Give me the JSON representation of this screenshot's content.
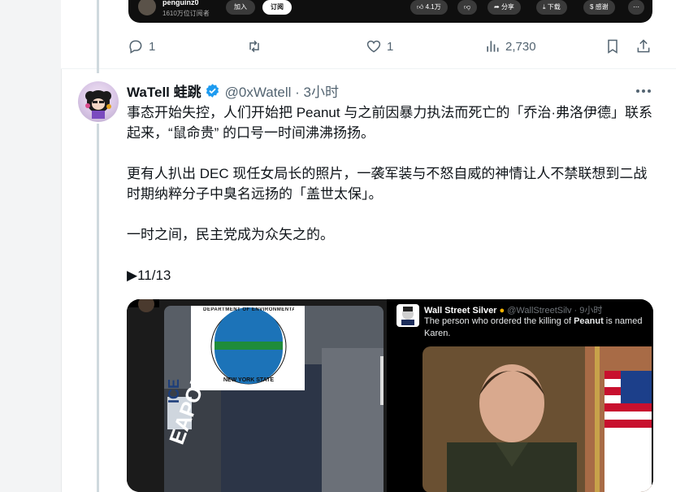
{
  "prev_media": {
    "channel_name": "penguinz0",
    "subscribers": "1610万位订阅者",
    "join_label": "加入",
    "subscribe_label": "订阅",
    "likes": "4.1万",
    "share_label": "分享",
    "download_label": "下载",
    "thanks_label": "感谢"
  },
  "prev_actions": {
    "replies": "1",
    "likes": "1",
    "views": "2,730"
  },
  "tweet": {
    "display_name": "WaTell 蛙跳",
    "handle_time": "@0xWatell · 3小时",
    "paragraphs": [
      "事态开始失控，人们开始把 Peanut 与之前因暴力执法而死亡的「乔治·弗洛伊德」联系起来，“鼠命贵” 的口号一时间沸沸扬扬。",
      "更有人扒出 DEC 现任女局长的照片，一袭军装与不怒自威的神情让人不禁联想到二战时期纳粹分子中臭名远扬的「盖世太保」。",
      "一时之间，民主党成为众矢之的。",
      "▶11/13"
    ],
    "embedded": {
      "seal_top": "DEPARTMENT OF ENVIRONMENTAL CONSERVATION",
      "seal_bottom": "NEW YORK STATE",
      "car_text_1": "ICE",
      "car_text_2": "EAPOLIS",
      "quoted_name": "Wall Street Silver",
      "quoted_handle_time": "@WallStreetSilv · 9小时",
      "quoted_text_before": "The person who ordered the killing of ",
      "quoted_text_bold": "Peanut",
      "quoted_text_after": " is named Karen."
    }
  },
  "colors": {
    "verified": "#1d9bf0",
    "thread_line": "#cfd9de",
    "secondary_text": "#536471"
  }
}
